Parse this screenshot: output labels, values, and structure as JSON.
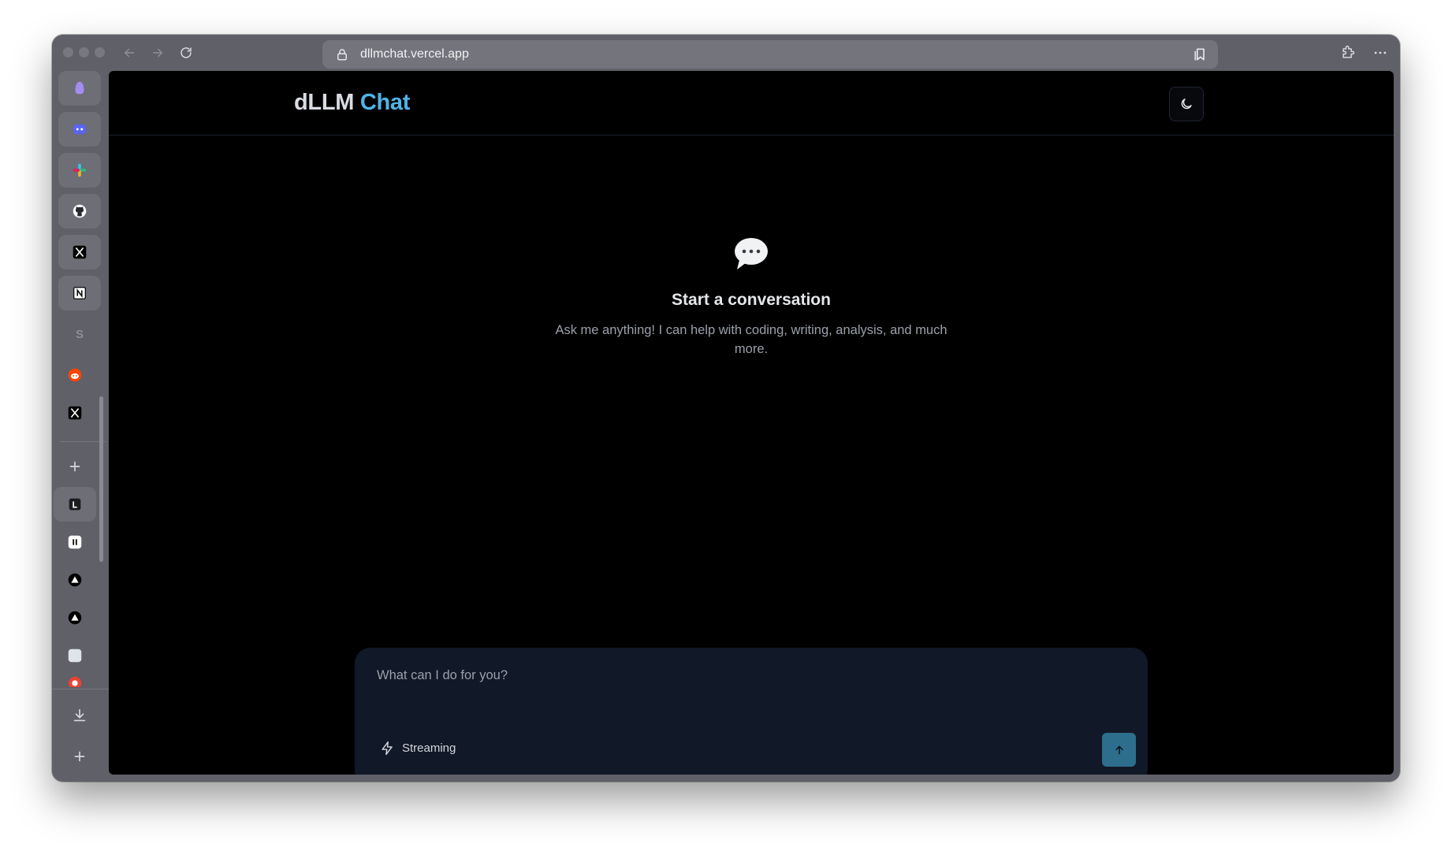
{
  "browser": {
    "url": "dllmchat.vercel.app"
  },
  "app": {
    "brand_part1": "dLLM",
    "brand_part2": "Chat",
    "brand_color": "#4fb3e8"
  },
  "sidebar": {
    "items": [
      {
        "icon": "tab-icon"
      },
      {
        "icon": "discord-icon"
      },
      {
        "icon": "slack-icon"
      },
      {
        "icon": "github-icon"
      },
      {
        "icon": "x-icon"
      },
      {
        "icon": "notion-icon"
      },
      {
        "icon": "s-letter-icon",
        "letter": "S"
      },
      {
        "icon": "reddit-icon"
      },
      {
        "icon": "x-icon"
      },
      {
        "icon": "plus-icon"
      },
      {
        "icon": "linear-icon"
      },
      {
        "icon": "pause-icon"
      },
      {
        "icon": "vercel-icon"
      },
      {
        "icon": "vercel-icon"
      },
      {
        "icon": "square-icon"
      },
      {
        "icon": "chrome-icon"
      },
      {
        "icon": "download-icon"
      },
      {
        "icon": "plus-icon"
      }
    ]
  },
  "empty_state": {
    "title": "Start a conversation",
    "subtitle": "Ask me anything! I can help with coding, writing, analysis, and much more."
  },
  "composer": {
    "placeholder": "What can I do for you?",
    "streaming_label": "Streaming",
    "send_color": "#2d6e8c"
  }
}
